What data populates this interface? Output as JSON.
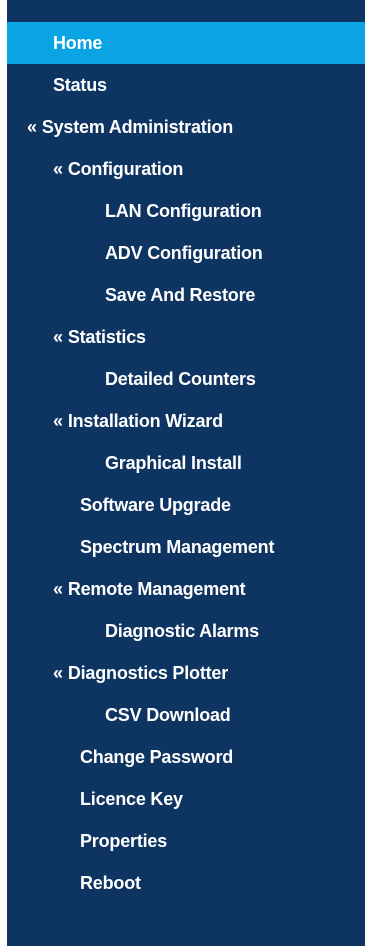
{
  "menu": {
    "arrow": "«",
    "home": "Home",
    "status": "Status",
    "system_administration": "System Administration",
    "configuration": "Configuration",
    "lan_configuration": "LAN Configuration",
    "adv_configuration": "ADV Configuration",
    "save_and_restore": "Save And Restore",
    "statistics": "Statistics",
    "detailed_counters": "Detailed Counters",
    "installation_wizard": "Installation Wizard",
    "graphical_install": "Graphical Install",
    "software_upgrade": "Software Upgrade",
    "spectrum_management": "Spectrum Management",
    "remote_management": "Remote Management",
    "diagnostic_alarms": "Diagnostic Alarms",
    "diagnostics_plotter": "Diagnostics Plotter",
    "csv_download": "CSV Download",
    "change_password": "Change Password",
    "licence_key": "Licence Key",
    "properties": "Properties",
    "reboot": "Reboot"
  },
  "colors": {
    "sidebar_bg": "#0e3462",
    "active_bg": "#0aa3e3",
    "text": "#ffffff"
  }
}
